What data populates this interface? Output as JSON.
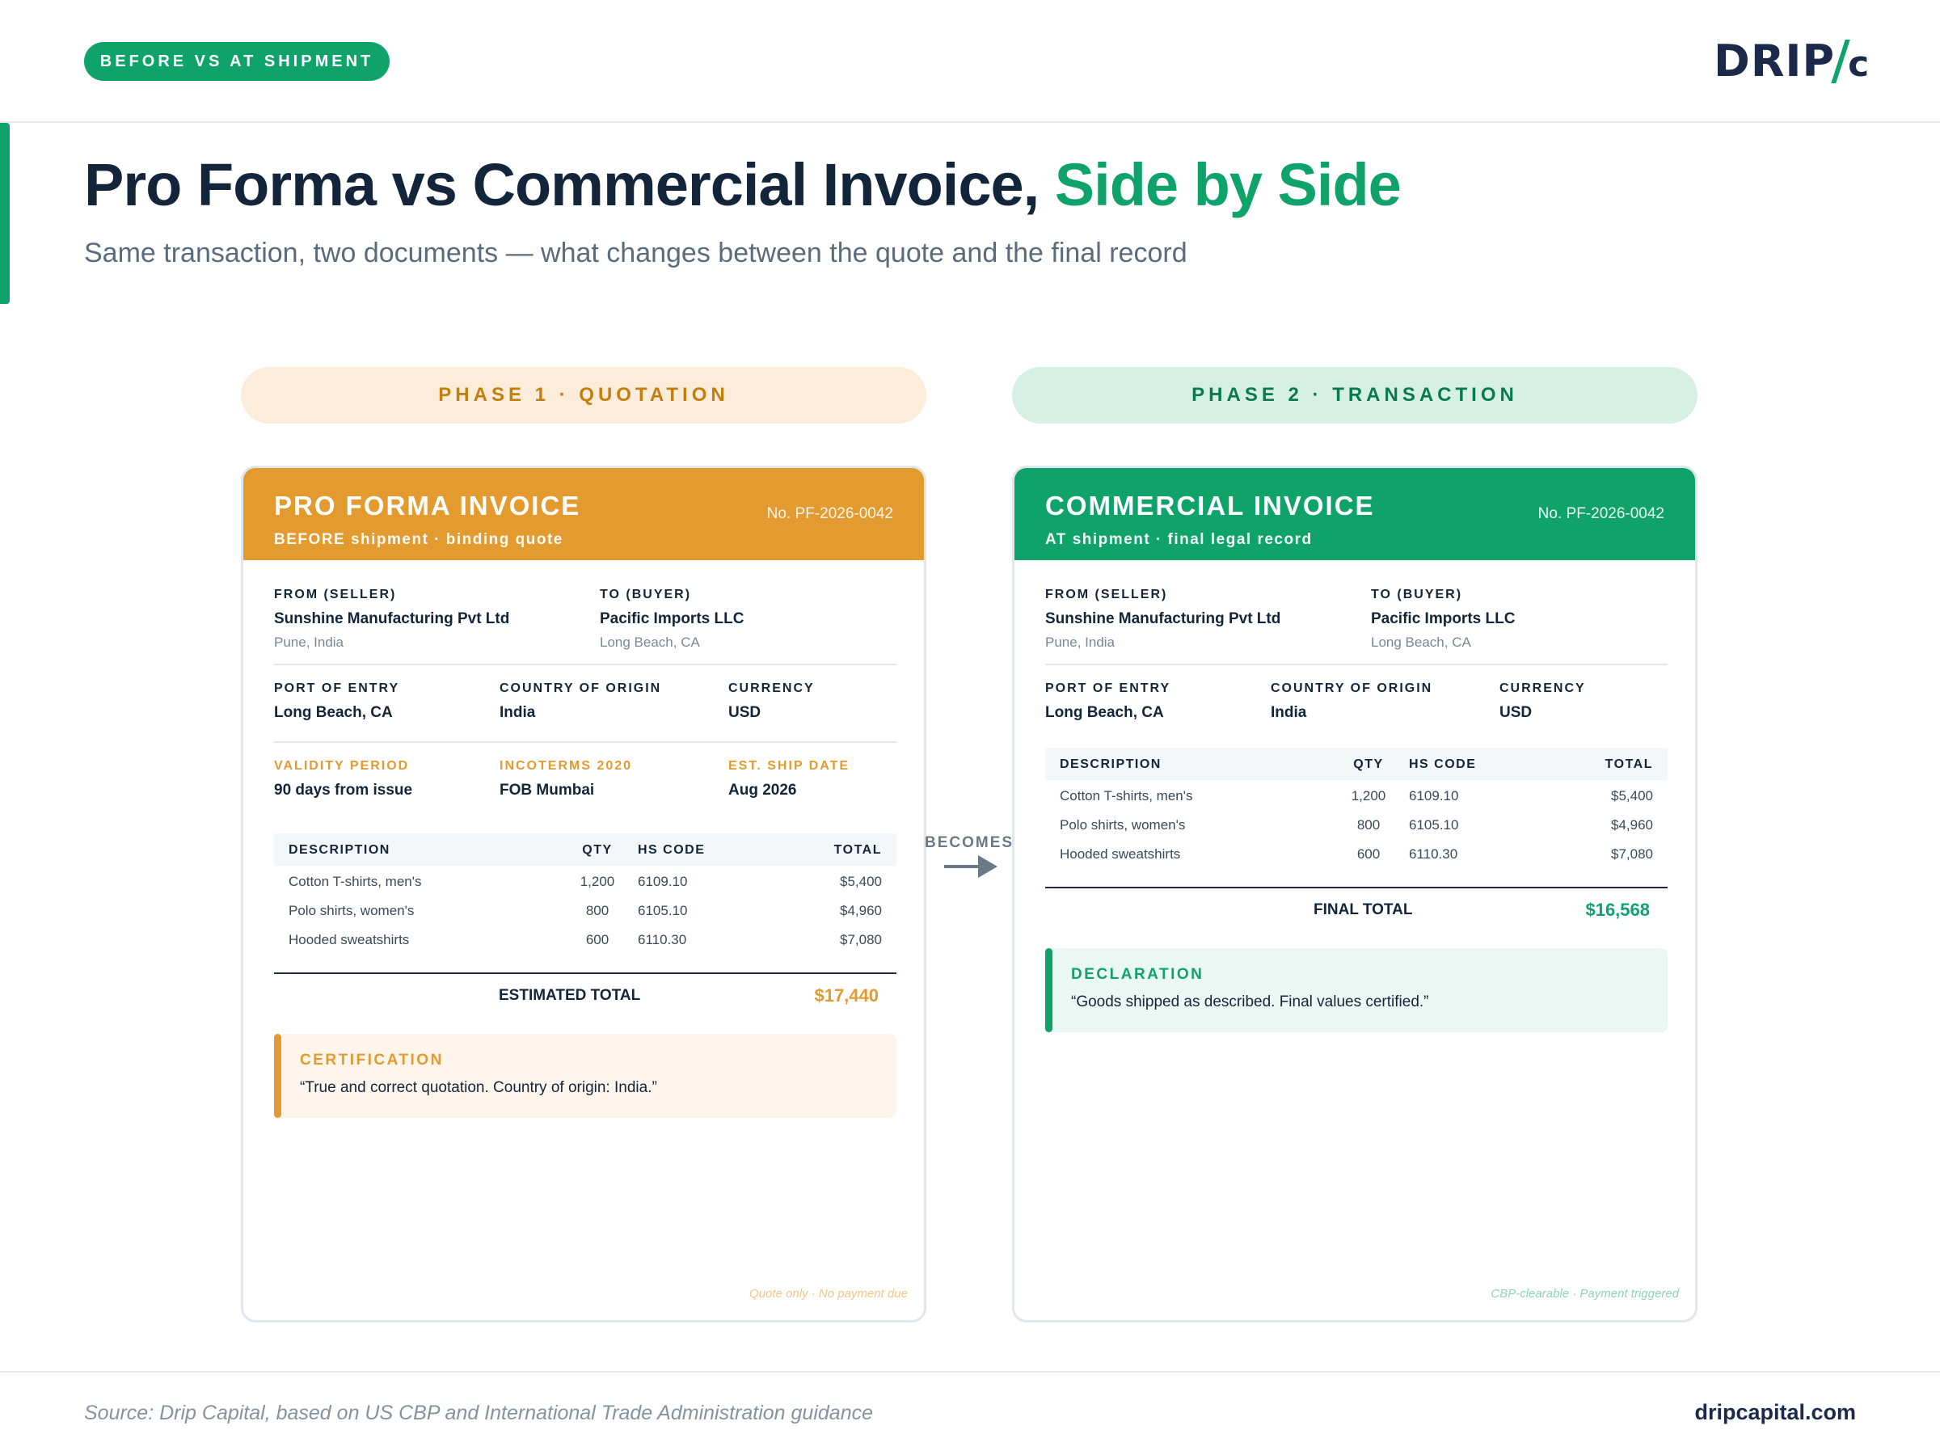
{
  "header": {
    "tag": "BEFORE VS AT SHIPMENT",
    "logo_text": "DRIP",
    "logo_suffix": "c",
    "title_main": "Pro Forma vs Commercial Invoice, ",
    "title_accent": "Side by Side",
    "subtitle": "Same transaction, two documents — what changes between the quote and the final record"
  },
  "colors": {
    "brand_green": "#0fa36b",
    "proforma_orange": "#e39a2e",
    "navy": "#13253a"
  },
  "phases": {
    "phase1": "PHASE 1 · QUOTATION",
    "phase2": "PHASE 2 · TRANSACTION"
  },
  "connector": {
    "label": "BECOMES",
    "icon": "arrow-right-icon"
  },
  "proforma": {
    "title": "PRO FORMA INVOICE",
    "subtitle": "BEFORE shipment · binding quote",
    "number": "No. PF-2026-0042",
    "seller_label": "FROM (SELLER)",
    "seller_name": "Sunshine Manufacturing Pvt Ltd",
    "seller_loc": "Pune, India",
    "buyer_label": "TO (BUYER)",
    "buyer_name": "Pacific Imports LLC",
    "buyer_loc": "Long Beach, CA",
    "port_label": "PORT OF ENTRY",
    "port_value": "Long Beach, CA",
    "origin_label": "COUNTRY OF ORIGIN",
    "origin_value": "India",
    "currency_label": "CURRENCY",
    "currency_value": "USD",
    "validity_label": "VALIDITY PERIOD",
    "validity_value": "90 days from issue",
    "incoterms_label": "INCOTERMS 2020",
    "incoterms_value": "FOB Mumbai",
    "ship_label": "EST. SHIP DATE",
    "ship_value": "Aug 2026",
    "table_headers": [
      "DESCRIPTION",
      "QTY",
      "HS CODE",
      "TOTAL"
    ],
    "rows": [
      [
        "Cotton T-shirts, men's",
        "1,200",
        "6109.10",
        "$5,400"
      ],
      [
        "Polo shirts, women's",
        "800",
        "6105.10",
        "$4,960"
      ],
      [
        "Hooded sweatshirts",
        "600",
        "6110.30",
        "$7,080"
      ]
    ],
    "total_label": "ESTIMATED TOTAL",
    "total_value": "$17,440",
    "note_title": "CERTIFICATION",
    "note_text": "“True and correct quotation. Country of origin: India.”",
    "footer": "Quote only · No payment due"
  },
  "commercial": {
    "title": "COMMERCIAL INVOICE",
    "subtitle": "AT shipment · final legal record",
    "number": "No. PF-2026-0042",
    "seller_label": "FROM (SELLER)",
    "seller_name": "Sunshine Manufacturing Pvt Ltd",
    "seller_loc": "Pune, India",
    "buyer_label": "TO (BUYER)",
    "buyer_name": "Pacific Imports LLC",
    "buyer_loc": "Long Beach, CA",
    "port_label": "PORT OF ENTRY",
    "port_value": "Long Beach, CA",
    "origin_label": "COUNTRY OF ORIGIN",
    "origin_value": "India",
    "currency_label": "CURRENCY",
    "currency_value": "USD",
    "table_headers": [
      "DESCRIPTION",
      "QTY",
      "HS CODE",
      "TOTAL"
    ],
    "rows": [
      [
        "Cotton T-shirts, men's",
        "1,200",
        "6109.10",
        "$5,400"
      ],
      [
        "Polo shirts, women's",
        "800",
        "6105.10",
        "$4,960"
      ],
      [
        "Hooded sweatshirts",
        "600",
        "6110.30",
        "$7,080"
      ]
    ],
    "total_label": "FINAL TOTAL",
    "total_value": "$16,568",
    "note_title": "DECLARATION",
    "note_text": "“Goods shipped as described. Final values certified.”",
    "footer": "CBP-clearable · Payment triggered"
  },
  "footer": {
    "source": "Source: Drip Capital, based on US CBP and International Trade Administration guidance",
    "site": "dripcapital.com"
  }
}
